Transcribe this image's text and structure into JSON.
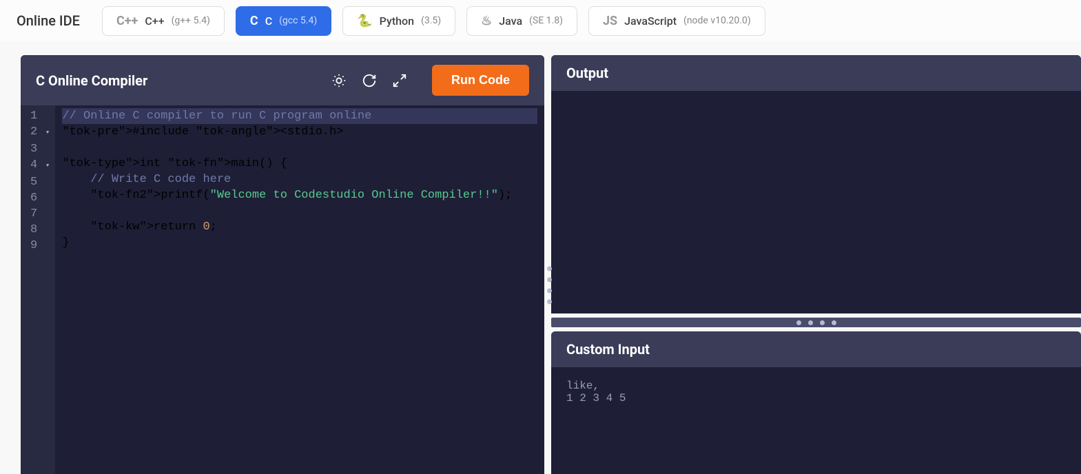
{
  "header": {
    "title": "Online IDE",
    "languages": [
      {
        "icon": "C++",
        "name": "C++",
        "version": "(g++ 5.4)",
        "active": false
      },
      {
        "icon": "C",
        "name": "C",
        "version": "(gcc 5.4)",
        "active": true
      },
      {
        "icon": "🐍",
        "name": "Python",
        "version": "(3.5)",
        "active": false
      },
      {
        "icon": "♨",
        "name": "Java",
        "version": "(SE 1.8)",
        "active": false
      },
      {
        "icon": "JS",
        "name": "JavaScript",
        "version": "(node v10.20.0)",
        "active": false
      }
    ]
  },
  "editor": {
    "title": "C Online Compiler",
    "run_label": "Run Code",
    "code_lines": [
      {
        "n": 1,
        "fold": "",
        "raw": "// Online C compiler to run C program online",
        "hl": true
      },
      {
        "n": 2,
        "fold": "▾",
        "raw": "#include <stdio.h>"
      },
      {
        "n": 3,
        "fold": "",
        "raw": ""
      },
      {
        "n": 4,
        "fold": "▾",
        "raw": "int main() {"
      },
      {
        "n": 5,
        "fold": "",
        "raw": "    // Write C code here"
      },
      {
        "n": 6,
        "fold": "",
        "raw": "    printf(\"Welcome to Codestudio Online Compiler!!\");"
      },
      {
        "n": 7,
        "fold": "",
        "raw": ""
      },
      {
        "n": 8,
        "fold": "",
        "raw": "    return 0;"
      },
      {
        "n": 9,
        "fold": "",
        "raw": "}"
      }
    ]
  },
  "output": {
    "title": "Output",
    "content": ""
  },
  "custom_input": {
    "title": "Custom Input",
    "content": "like,\n1 2 3 4 5"
  },
  "colors": {
    "accent": "#2e6de7",
    "run": "#f26c1a",
    "panel_bg": "#1e1f36",
    "panel_header": "#3a3c58"
  }
}
